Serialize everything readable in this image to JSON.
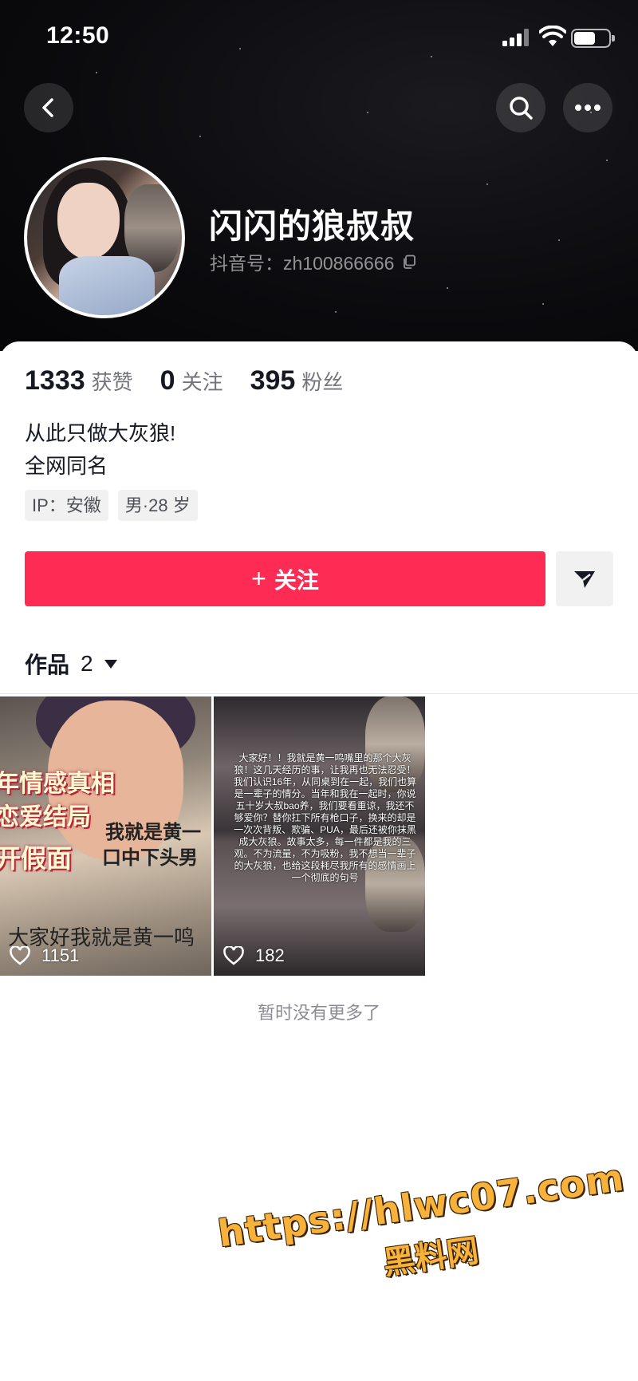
{
  "status_bar": {
    "time": "12:50"
  },
  "profile": {
    "nickname": "闪闪的狼叔叔",
    "douyin_id_label": "抖音号：zh100866666",
    "stats": [
      {
        "value": "1333",
        "label": "获赞"
      },
      {
        "value": "0",
        "label": "关注"
      },
      {
        "value": "395",
        "label": "粉丝"
      }
    ],
    "bio_lines": [
      "从此只做大灰狼!",
      "全网同名"
    ],
    "tags": [
      "IP：安徽",
      "男·28 岁"
    ]
  },
  "actions": {
    "follow_label": "关注",
    "follow_plus": "+"
  },
  "works": {
    "tab_label": "作品",
    "count": "2",
    "videos": [
      {
        "likes": "1151",
        "overlay_texts": [
          "年情感真相",
          "恋爱结局",
          "我就是黄一",
          "口中下头男",
          "开假面"
        ],
        "caption": "大家好我就是黄一鸣"
      },
      {
        "likes": "182",
        "overlay_text": "大家好！！我就是黄一鸣嘴里的那个大灰狼！这几天经历的事，让我再也无法忍受！我们认识16年，从同桌到在一起，我们也算是一辈子的情分。当年和我在一起时，你说五十岁大叔bao养，我们要看重谅，我还不够爱你？替你扛下所有枪口子，换来的却是一次次背叛、欺骗、PUA，最后还被你抹黑成大灰狼。故事太多，每一件都是我的三观。不为流量，不为吸粉，我不想当一辈子的大灰狼，也给这段耗尽我所有的感情画上一个彻底的句号"
      }
    ],
    "no_more_text": "暂时没有更多了"
  },
  "watermark": {
    "url": "https://hlwc07.com",
    "name": "黑料网"
  },
  "colors": {
    "accent": "#fe2c55",
    "text": "#161823",
    "watermark": "#f7b23b"
  },
  "icons": [
    "back-icon",
    "search-icon",
    "more-icon",
    "copy-icon",
    "share-icon",
    "heart-icon",
    "caret-down-icon"
  ]
}
